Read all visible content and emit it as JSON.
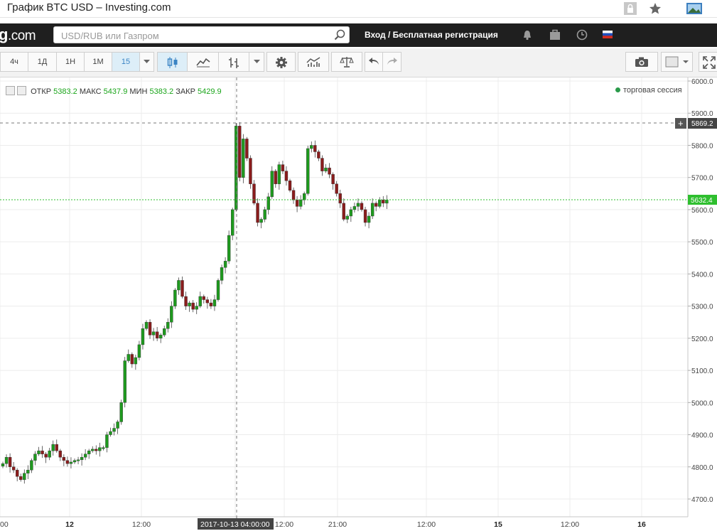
{
  "window": {
    "title": "График BTC USD – Investing.com"
  },
  "nav": {
    "logo_main": "g",
    "logo_dot": ".com",
    "search_placeholder": "USD/RUB или Газпром",
    "login": "Вход / Бесплатная регистрация"
  },
  "toolbar": {
    "timeframes": [
      "4ч",
      "1Д",
      "1Н",
      "1М",
      "15"
    ],
    "active_timeframe": "15"
  },
  "legend": {
    "open_label": "ОТКР",
    "open": "5383.2",
    "high_label": "МАКС",
    "high": "5437.9",
    "low_label": "МИН",
    "low": "5383.2",
    "close_label": "ЗАКР",
    "close": "5429.9",
    "session": "торговая сессия"
  },
  "colors": {
    "up": "#1e9a1e",
    "down": "#8a1c1c",
    "price_line": "#2fbf2f",
    "header": "#1f1f1f"
  },
  "chart_data": {
    "type": "candlestick",
    "y_ticks": [
      "6000.0",
      "5900.0",
      "5800.0",
      "5700.0",
      "5600.0",
      "5500.0",
      "5400.0",
      "5300.0",
      "5200.0",
      "5100.0",
      "5000.0",
      "4900.0",
      "4800.0",
      "4700.0"
    ],
    "ylim": [
      4670,
      6020
    ],
    "x_ticks": [
      "00",
      "12",
      "12:00",
      "2017-10-13 04:00:00",
      "12:00",
      "21:00",
      "12:00",
      "15",
      "12:00",
      "16"
    ],
    "crosshair_price": "5869.2",
    "crosshair_time": "2017-10-13 04:00:00",
    "last_price": "5632.4",
    "closes": [
      4810,
      4830,
      4800,
      4790,
      4770,
      4760,
      4780,
      4790,
      4820,
      4840,
      4850,
      4840,
      4830,
      4850,
      4870,
      4850,
      4830,
      4820,
      4810,
      4815,
      4820,
      4822,
      4830,
      4840,
      4850,
      4855,
      4850,
      4860,
      4860,
      4900,
      4910,
      4920,
      4940,
      5000,
      5130,
      5150,
      5120,
      5140,
      5180,
      5230,
      5250,
      5210,
      5220,
      5200,
      5210,
      5230,
      5250,
      5300,
      5350,
      5380,
      5330,
      5300,
      5310,
      5290,
      5300,
      5330,
      5320,
      5310,
      5300,
      5320,
      5380,
      5420,
      5440,
      5520,
      5600,
      5860,
      5700,
      5820,
      5760,
      5680,
      5620,
      5560,
      5570,
      5600,
      5640,
      5720,
      5680,
      5740,
      5720,
      5690,
      5660,
      5630,
      5610,
      5630,
      5650,
      5790,
      5800,
      5780,
      5760,
      5720,
      5730,
      5710,
      5680,
      5650,
      5620,
      5570,
      5580,
      5600,
      5610,
      5620,
      5600,
      5560,
      5580,
      5620,
      5610,
      5630,
      5620,
      5630
    ]
  }
}
